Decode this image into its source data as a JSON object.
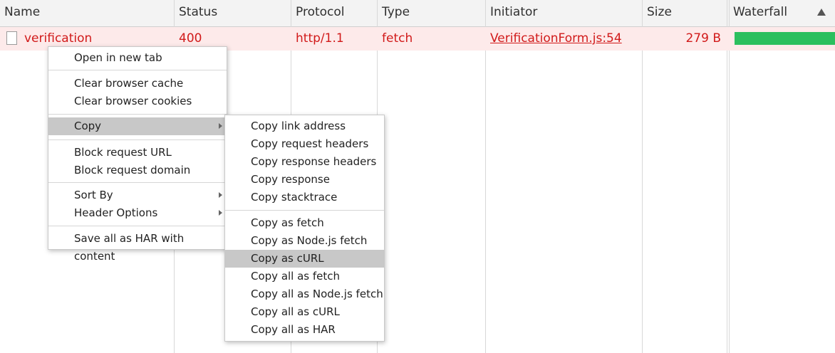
{
  "columns": {
    "name": "Name",
    "status": "Status",
    "protocol": "Protocol",
    "type": "Type",
    "initiator": "Initiator",
    "size": "Size",
    "waterfall": "Waterfall"
  },
  "request": {
    "name": "verification",
    "status": "400",
    "protocol": "http/1.1",
    "type": "fetch",
    "initiator": "VerificationForm.js:54",
    "size": "279 B"
  },
  "context_menu": {
    "open_new_tab": "Open in new tab",
    "clear_cache": "Clear browser cache",
    "clear_cookies": "Clear browser cookies",
    "copy": "Copy",
    "block_url": "Block request URL",
    "block_domain": "Block request domain",
    "sort_by": "Sort By",
    "header_options": "Header Options",
    "save_har": "Save all as HAR with content"
  },
  "copy_submenu": {
    "link_address": "Copy link address",
    "request_headers": "Copy request headers",
    "response_headers": "Copy response headers",
    "response": "Copy response",
    "stacktrace": "Copy stacktrace",
    "as_fetch": "Copy as fetch",
    "as_node_fetch": "Copy as Node.js fetch",
    "as_curl": "Copy as cURL",
    "all_as_fetch": "Copy all as fetch",
    "all_as_node_fetch": "Copy all as Node.js fetch",
    "all_as_curl": "Copy all as cURL",
    "all_as_har": "Copy all as HAR"
  },
  "colors": {
    "error_text": "#d11a1a",
    "error_row_bg": "#fdeaea",
    "waterfall_bar": "#2cbf5e",
    "menu_highlight": "#c8c8c8"
  }
}
